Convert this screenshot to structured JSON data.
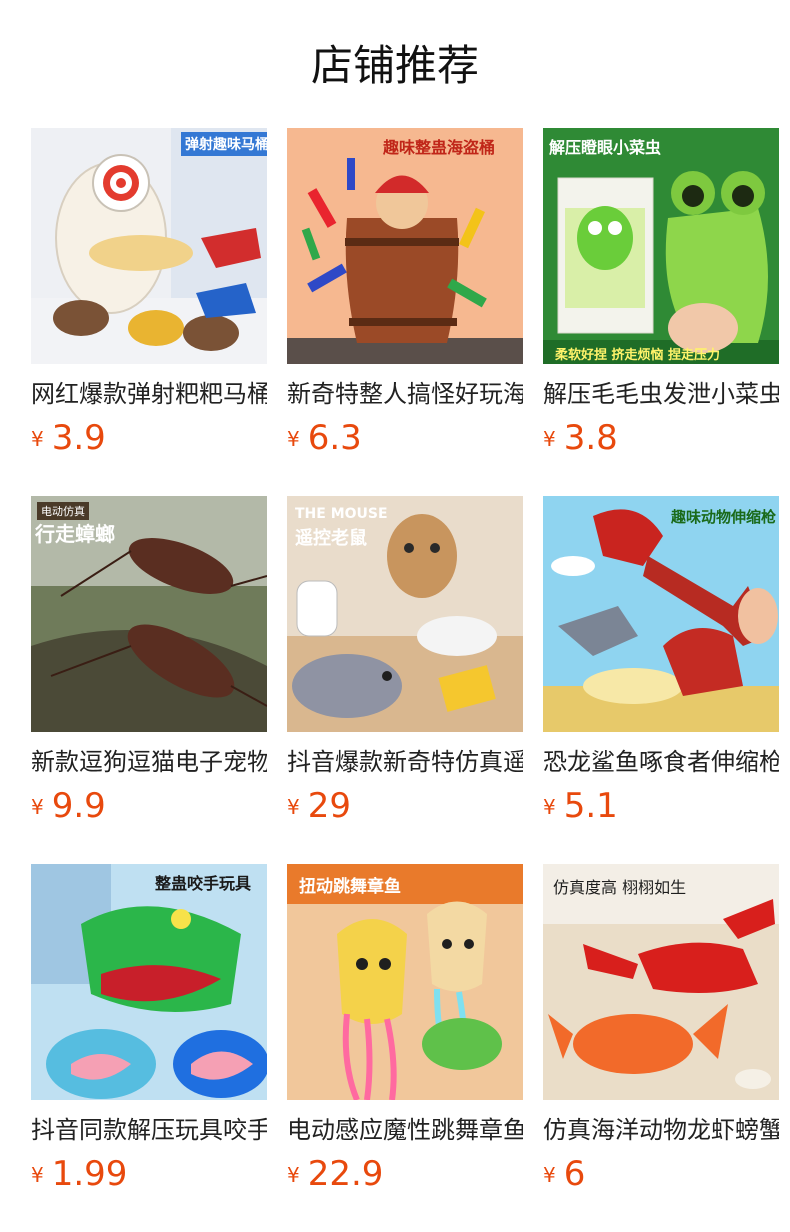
{
  "header": {
    "title": "店铺推荐"
  },
  "currency_symbol": "¥",
  "colors": {
    "price": "#e8490d",
    "title": "#111111",
    "name": "#222222"
  },
  "products": [
    {
      "name": "网红爆款弹射粑粑马桶",
      "price": "3.9",
      "image_text": "弹射趣味马桶",
      "icon": "toilet-toy-icon"
    },
    {
      "name": "新奇特整人搞怪好玩海盗桶",
      "price": "6.3",
      "image_text": "趣味整蛊海盗桶",
      "icon": "pirate-barrel-icon"
    },
    {
      "name": "解压毛毛虫发泄小菜虫",
      "price": "3.8",
      "image_text": "解压瞪眼小菜虫",
      "image_caption": "柔软好捏 挤走烦恼 捏走压力",
      "icon": "squeeze-bug-icon"
    },
    {
      "name": "新款逗狗逗猫电子宠物蟑螂",
      "price": "9.9",
      "image_text": "行走蟑螂",
      "image_tag": "电动仿真",
      "icon": "cockroach-icon"
    },
    {
      "name": "抖音爆款新奇特仿真遥控老鼠",
      "price": "29",
      "image_text": "遥控老鼠",
      "image_tag": "THE MOUSE",
      "icon": "mouse-toy-icon"
    },
    {
      "name": "恐龙鲨鱼啄食者伸缩枪",
      "price": "5.1",
      "image_text": "趣味动物伸缩枪",
      "icon": "dinosaur-grabber-icon"
    },
    {
      "name": "抖音同款解压玩具咬手鳄鱼",
      "price": "1.99",
      "image_text": "整蛊咬手玩具",
      "icon": "crocodile-dentist-icon"
    },
    {
      "name": "电动感应魔性跳舞章鱼",
      "price": "22.9",
      "image_text": "扭动跳舞章鱼",
      "icon": "dancing-octopus-icon"
    },
    {
      "name": "仿真海洋动物龙虾螃蟹",
      "price": "6",
      "image_text": "仿真度高 栩栩如生",
      "icon": "lobster-crab-icon"
    }
  ]
}
